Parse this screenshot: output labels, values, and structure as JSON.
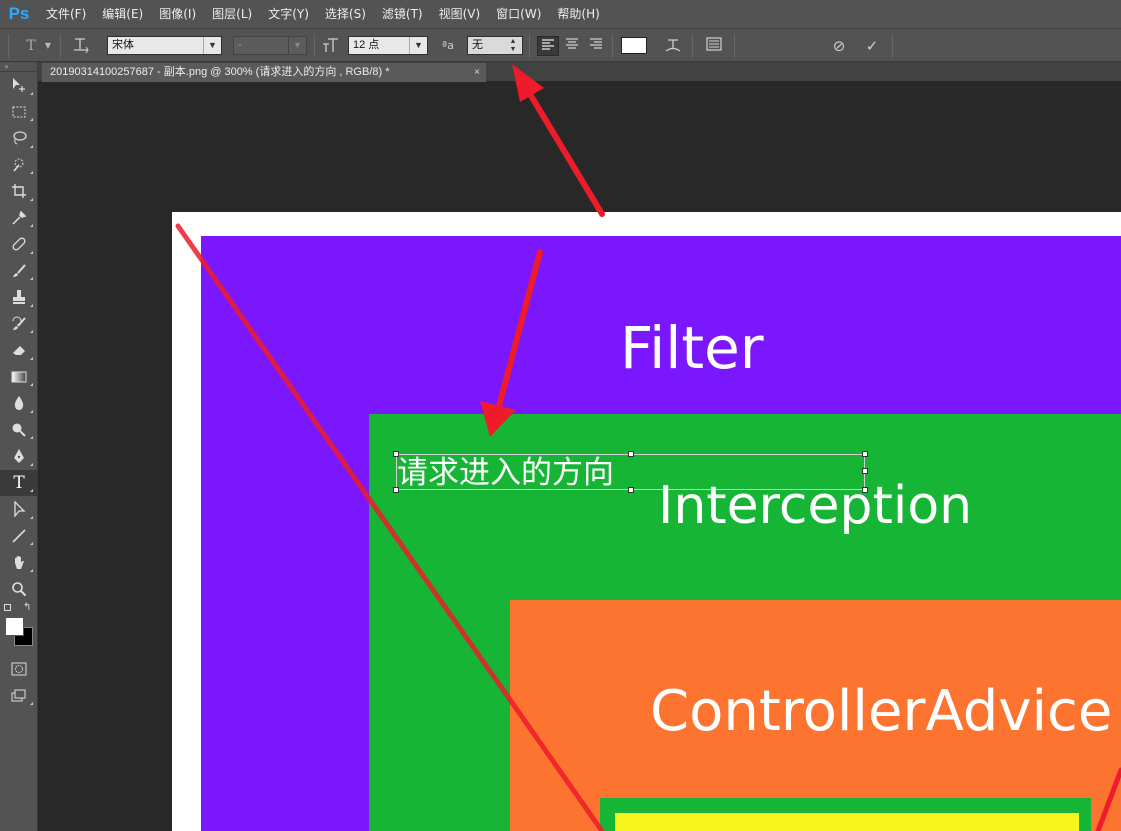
{
  "app": {
    "logo": "Ps"
  },
  "menubar": {
    "items": [
      "文件(F)",
      "编辑(E)",
      "图像(I)",
      "图层(L)",
      "文字(Y)",
      "选择(S)",
      "滤镜(T)",
      "视图(V)",
      "窗口(W)",
      "帮助(H)"
    ]
  },
  "options": {
    "tool_icon": "T",
    "font_family": "宋体",
    "font_style": "-",
    "font_size": "12 点",
    "antialias_label": "ªa",
    "antialias": "无",
    "commit_cancel_icon": "⊘",
    "commit_ok_icon": "✓"
  },
  "tab": {
    "title": "20190314100257687 - 副本.png @ 300% (请求进入的方向         , RGB/8) *",
    "close": "×"
  },
  "canvas": {
    "filter_label": "Filter",
    "interception_label": "Interception",
    "advice_label": "ControllerAdvice",
    "typing_text": "请求进入的方向"
  },
  "colors": {
    "filter": "#7a17fc",
    "interception": "#16b535",
    "advice": "#fd7330",
    "yellow": "#f6f51e",
    "annotation": "#ee1c2a"
  },
  "icons": {
    "tools": [
      "move-icon",
      "marquee-icon",
      "lasso-icon",
      "quick-select-icon",
      "crop-icon",
      "eyedropper-icon",
      "healing-brush-icon",
      "brush-icon",
      "clone-stamp-icon",
      "history-brush-icon",
      "eraser-icon",
      "gradient-icon",
      "blur-icon",
      "dodge-icon",
      "pen-icon",
      "type-icon",
      "path-select-icon",
      "line-icon",
      "hand-icon",
      "zoom-icon"
    ]
  }
}
